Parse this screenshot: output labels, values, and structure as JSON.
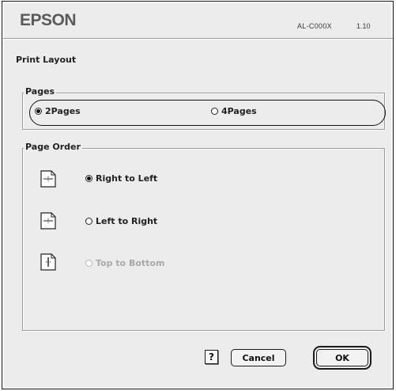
{
  "header": {
    "brand": "EPSON",
    "model": "AL-C000X",
    "version": "1.10"
  },
  "section_title": "Print Layout",
  "pages_group": {
    "label": "Pages",
    "options": [
      {
        "label": "2Pages",
        "selected": true
      },
      {
        "label": "4Pages",
        "selected": false
      }
    ]
  },
  "page_order_group": {
    "label": "Page Order",
    "options": [
      {
        "label": "Right to Left",
        "selected": true,
        "enabled": true,
        "icon": "horizontal-order-icon"
      },
      {
        "label": "Left to Right",
        "selected": false,
        "enabled": true,
        "icon": "horizontal-order-icon"
      },
      {
        "label": "Top to Bottom",
        "selected": false,
        "enabled": false,
        "icon": "vertical-order-icon"
      }
    ]
  },
  "buttons": {
    "help": "?",
    "cancel": "Cancel",
    "ok": "OK"
  },
  "colors": {
    "dialog_bg": "#ececec",
    "border": "#1e1e1e",
    "disabled_text": "#a8a8a8"
  }
}
